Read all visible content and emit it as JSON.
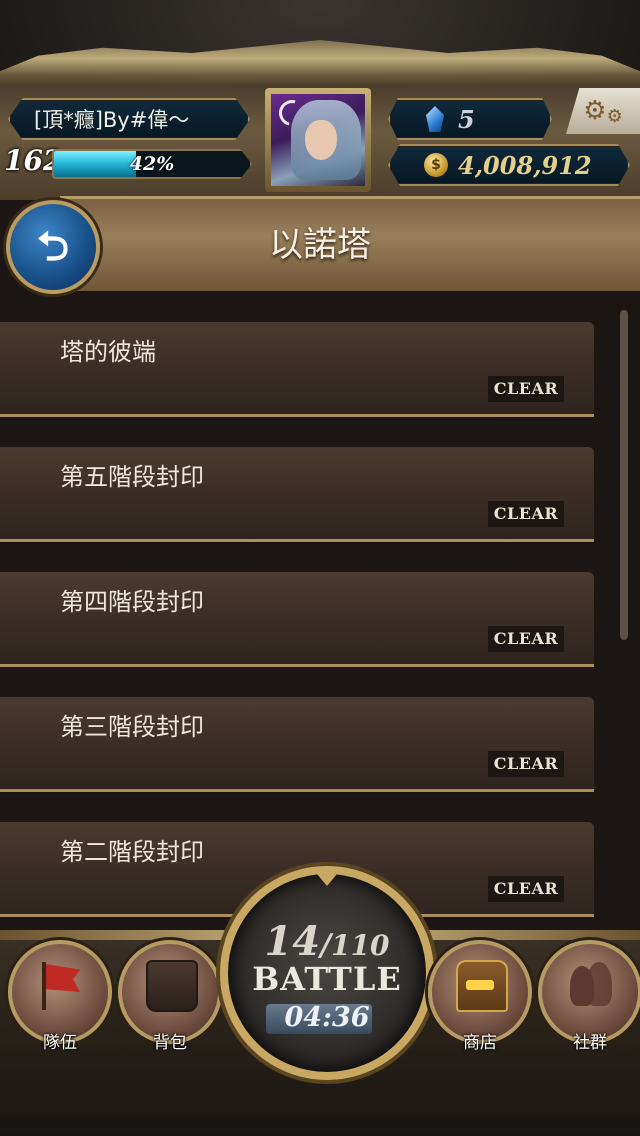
{
  "header": {
    "player_name": "[頂*癮]By#偉～",
    "level": "162",
    "exp_percent_label": "42%",
    "exp_fraction": 0.42,
    "gems": "5",
    "gold": "4,008,912",
    "settings_icon": "gear-icon",
    "avatar_icon": "character-portrait"
  },
  "title_bar": {
    "title": "以諾塔",
    "back_icon": "back-arrow-icon"
  },
  "floors": [
    {
      "label": "塔的彼端",
      "badge": "CLEAR"
    },
    {
      "label": "第五階段封印",
      "badge": "CLEAR"
    },
    {
      "label": "第四階段封印",
      "badge": "CLEAR"
    },
    {
      "label": "第三階段封印",
      "badge": "CLEAR"
    },
    {
      "label": "第二階段封印",
      "badge": "CLEAR"
    }
  ],
  "bottom_nav": {
    "team": {
      "label": "隊伍",
      "icon": "flag-icon"
    },
    "bag": {
      "label": "背包",
      "icon": "bag-icon"
    },
    "shop": {
      "label": "商店",
      "icon": "chest-icon"
    },
    "social": {
      "label": "社群",
      "icon": "people-icon"
    },
    "battle": {
      "stamina_current": "14",
      "stamina_separator": "/",
      "stamina_max": "110",
      "label": "BATTLE",
      "timer": "04:36"
    }
  },
  "colors": {
    "exp_fill": "#22b6d6",
    "gold_text": "#e3cf8e",
    "frame_gold": "#b59a63",
    "background": "#1c1714"
  }
}
